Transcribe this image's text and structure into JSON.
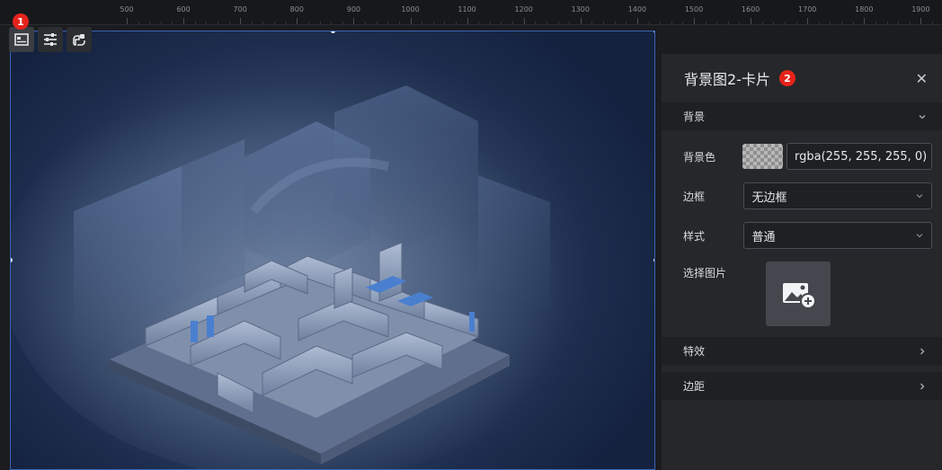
{
  "ruler": {
    "labels": [
      "500",
      "600",
      "700",
      "800",
      "900",
      "1000",
      "1100",
      "1200",
      "1300",
      "1400",
      "1500",
      "1600",
      "1700",
      "1800",
      "1900"
    ]
  },
  "markers": {
    "m1": "1",
    "m2": "2"
  },
  "toolbar": {
    "icons": [
      "image-card-icon",
      "sliders-icon",
      "component-icon"
    ]
  },
  "panel": {
    "title": "背景图2-卡片",
    "close": "✕",
    "background_section": "背景",
    "bg_color_label": "背景色",
    "bg_color_value": "rgba(255, 255, 255, 0)",
    "border_label": "边框",
    "border_value": "无边框",
    "style_label": "样式",
    "style_value": "普通",
    "image_label": "选择图片",
    "effects_section": "特效",
    "margin_section": "边距"
  },
  "colors": {
    "accent_border": "#3a64b4",
    "panel_bg": "#25272b",
    "marker_red": "#e5231b"
  }
}
